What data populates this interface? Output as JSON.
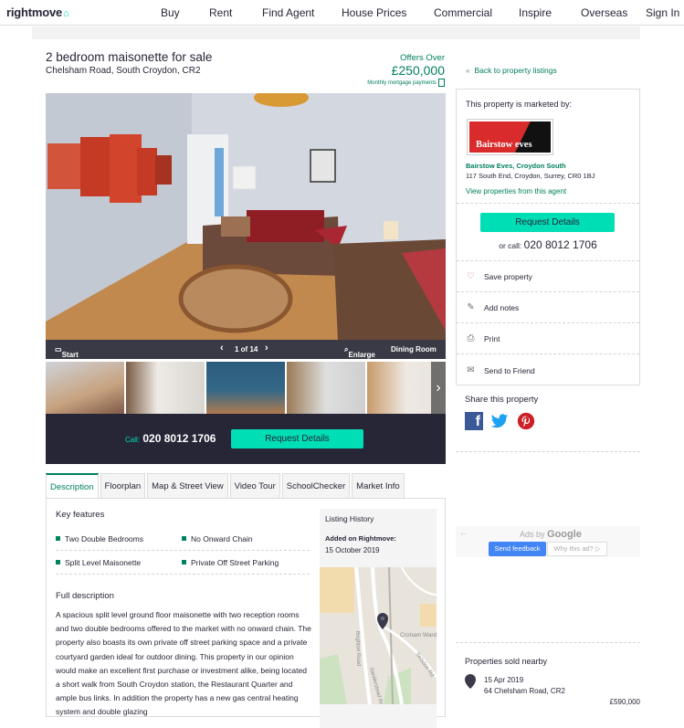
{
  "header": {
    "logo": "rightmove",
    "nav": [
      "Buy",
      "Rent",
      "Find Agent",
      "House Prices",
      "Commercial",
      "Inspire",
      "Overseas",
      "Sign In"
    ]
  },
  "listing": {
    "title": "2 bedroom maisonette for sale",
    "address": "Chelsham Road, South Croydon, CR2",
    "price_qualifier": "Offers Over",
    "price": "£250,000",
    "mortgage_link": "Monthly mortgage payments"
  },
  "gallery": {
    "start_slideshow": "Start slideshow",
    "counter": "1 of 14",
    "enlarge": "Enlarge",
    "caption": "Dining Room",
    "call_label": "Call:",
    "phone": "020 8012 1706",
    "request_details": "Request Details"
  },
  "tabs": [
    "Description",
    "Floorplan",
    "Map & Street View",
    "Video Tour",
    "SchoolChecker",
    "Market Info"
  ],
  "description": {
    "key_features_title": "Key features",
    "features": [
      "Two Double Bedrooms",
      "No Onward Chain",
      "Split Level Maisonette",
      "Private Off Street Parking"
    ],
    "full_description_title": "Full description",
    "text": "A spacious split level ground floor maisonette with two reception rooms and two double bedrooms offered to the market with no onward chain. The property also boasts its own private off street parking space and a private courtyard garden ideal for outdoor dining. This property in our opinion would make an excellent first purchase or investment alike, being located a short walk from South Croydon station, the Restaurant Quarter and ample bus links. In addition the property has a new gas central heating system and double glazing"
  },
  "listing_history": {
    "title": "Listing History",
    "added_label": "Added on Rightmove:",
    "added_date": "15 October 2019",
    "map_labels": [
      "Brighton Road",
      "Sanderstead Road",
      "Croham Ward",
      "Selsdon Rd"
    ]
  },
  "sidebar": {
    "back": "Back to property listings",
    "marketed_by": "This property is marketed by:",
    "agent_logo_text": "Bairstow eves",
    "agent_name": "Bairstow Eves, Croydon South",
    "agent_address": "117 South End, Croydon, Surrey, CR0 1BJ",
    "view_properties": "View properties from this agent",
    "request_details": "Request Details",
    "or_call": "or call:",
    "phone": "020 8012 1706",
    "actions": [
      "Save property",
      "Add notes",
      "Print",
      "Send to Friend"
    ],
    "share_title": "Share this property",
    "ads_by": "Ads by",
    "google": "Google",
    "send_feedback": "Send feedback",
    "why_ad": "Why this ad?",
    "sold_title": "Properties sold nearby",
    "sold": [
      {
        "date": "15 Apr 2019",
        "address": "64 Chelsham Road, CR2",
        "price": "£590,000"
      }
    ]
  },
  "colors": {
    "brand_green": "#00deb6",
    "text_green": "#00805e",
    "navy": "#262637"
  }
}
